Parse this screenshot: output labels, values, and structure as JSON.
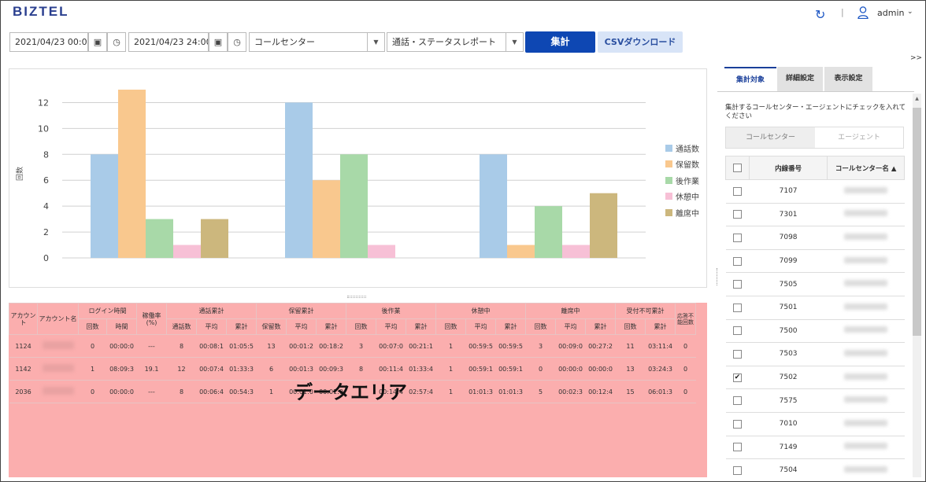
{
  "header": {
    "logo": "BIZTEL",
    "refresh_icon": "refresh-icon",
    "separator": "|",
    "user_icon": "user-icon",
    "user_name": "admin",
    "user_caret": "⌄"
  },
  "filters": {
    "start_datetime": "2021/04/23 00:00",
    "end_datetime": "2021/04/23 24:00",
    "call_center_select": "コールセンター",
    "report_select": "通話・ステータスレポート",
    "aggregate_button": "集計",
    "csv_button": "CSVダウンロード",
    "expand_toggle": ">>"
  },
  "chart_data": {
    "type": "bar",
    "categories": [
      "",
      "",
      ""
    ],
    "ylabel": "回数",
    "ylim": [
      0,
      13
    ],
    "yticks": [
      0,
      2,
      4,
      6,
      8,
      10,
      12
    ],
    "legend_position": "right",
    "grid": true,
    "series": [
      {
        "name": "通話数",
        "color": "#a9cbe8",
        "values": [
          8,
          12,
          8
        ]
      },
      {
        "name": "保留数",
        "color": "#f9c88e",
        "values": [
          13,
          6,
          1
        ]
      },
      {
        "name": "後作業",
        "color": "#a8d9a8",
        "values": [
          3,
          8,
          4
        ]
      },
      {
        "name": "休憩中",
        "color": "#f7c0d6",
        "values": [
          1,
          1,
          1
        ]
      },
      {
        "name": "離席中",
        "color": "#ccb77d",
        "values": [
          3,
          0,
          5
        ]
      }
    ]
  },
  "data_table": {
    "group_headers": {
      "account": "アカウント",
      "account_name": "アカウント名",
      "login_time": "ログイン時間",
      "occupancy": "稼働率(%)",
      "calls": "通話累計",
      "hold": "保留累計",
      "aftercall": "後作業",
      "break": "休憩中",
      "away": "離席中",
      "refused": "受付不可累計",
      "unanswered": "応答不能回数"
    },
    "sub_headers": {
      "count": "回数",
      "time": "時間",
      "call_count": "通話数",
      "avg": "平均",
      "total": "累計",
      "hold_count": "保留数"
    },
    "rows": [
      {
        "account": "1124",
        "c1": "0",
        "c2": "00:00:0",
        "c3": "---",
        "c4": "8",
        "c5": "00:08:1",
        "c6": "01:05:5",
        "c7": "13",
        "c8": "00:01:2",
        "c9": "00:18:2",
        "c10": "3",
        "c11": "00:07:0",
        "c12": "00:21:1",
        "c13": "1",
        "c14": "00:59:5",
        "c15": "00:59:5",
        "c16": "3",
        "c17": "00:09:0",
        "c18": "00:27:2",
        "c19": "11",
        "c20": "03:11:4",
        "c21": "0"
      },
      {
        "account": "1142",
        "c1": "1",
        "c2": "08:09:3",
        "c3": "19.1",
        "c4": "12",
        "c5": "00:07:4",
        "c6": "01:33:3",
        "c7": "6",
        "c8": "00:01:3",
        "c9": "00:09:3",
        "c10": "8",
        "c11": "00:11:4",
        "c12": "01:33:4",
        "c13": "1",
        "c14": "00:59:1",
        "c15": "00:59:1",
        "c16": "0",
        "c17": "00:00:0",
        "c18": "00:00:0",
        "c19": "13",
        "c20": "03:24:3",
        "c21": "0"
      },
      {
        "account": "2036",
        "c1": "0",
        "c2": "00:00:0",
        "c3": "---",
        "c4": "8",
        "c5": "00:06:4",
        "c6": "00:54:3",
        "c7": "1",
        "c8": "00:01:0",
        "c9": "00:01:0",
        "c10": "",
        "c11": "00:14:4",
        "c12": "02:57:4",
        "c13": "1",
        "c14": "01:01:3",
        "c15": "01:01:3",
        "c16": "5",
        "c17": "00:02:3",
        "c18": "00:12:4",
        "c19": "15",
        "c20": "06:01:3",
        "c21": "0"
      }
    ],
    "overlay_label": "データエリア"
  },
  "right_panel": {
    "tabs": [
      "集計対象",
      "詳細設定",
      "表示設定"
    ],
    "description": "集計するコールセンター・エージェントにチェックを入れてください",
    "segment": {
      "call_center": "コールセンター",
      "agent": "エージェント"
    },
    "table_headers": {
      "extension": "内線番号",
      "name": "コールセンター名 ▲"
    },
    "rows": [
      {
        "ext": "7107",
        "checked": false
      },
      {
        "ext": "7301",
        "checked": false
      },
      {
        "ext": "7098",
        "checked": false
      },
      {
        "ext": "7099",
        "checked": false
      },
      {
        "ext": "7505",
        "checked": false
      },
      {
        "ext": "7501",
        "checked": false
      },
      {
        "ext": "7500",
        "checked": false
      },
      {
        "ext": "7503",
        "checked": false
      },
      {
        "ext": "7502",
        "checked": true
      },
      {
        "ext": "7575",
        "checked": false
      },
      {
        "ext": "7010",
        "checked": false
      },
      {
        "ext": "7149",
        "checked": false
      },
      {
        "ext": "7504",
        "checked": false
      }
    ]
  }
}
